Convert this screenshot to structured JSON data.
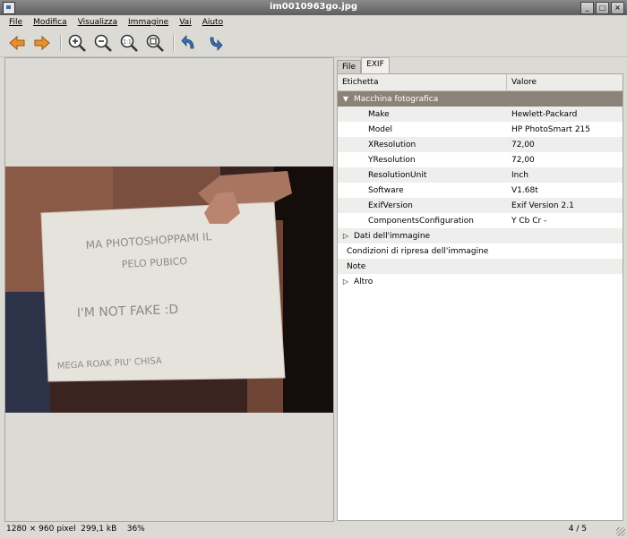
{
  "window": {
    "title": "im0010963go.jpg"
  },
  "menu": [
    "File",
    "Modifica",
    "Visualizza",
    "Immagine",
    "Vai",
    "Aiuto"
  ],
  "toolbar": {
    "icons": [
      "arrow-left-icon",
      "arrow-right-icon",
      "zoom-in-icon",
      "zoom-out-icon",
      "zoom-fit-icon",
      "zoom-original-icon",
      "rotate-left-icon",
      "rotate-right-icon"
    ],
    "accent": "#e8912a",
    "rotate_color": "#3a6fb4"
  },
  "photo": {
    "sign_lines": [
      "MA PHOTOSHOPPAMI IL",
      "PELO PUBICO",
      "I'M NOT FAKE :D",
      "MEGA ROAK PIU' CHISA"
    ]
  },
  "sidebar": {
    "tabs": [
      "File",
      "EXIF"
    ],
    "active_tab": "EXIF",
    "columns": [
      "Etichetta",
      "Valore"
    ],
    "rows": [
      {
        "label": "Macchina fotografica",
        "value": "",
        "level": 0,
        "expander": "expanded",
        "selected": true
      },
      {
        "label": "Make",
        "value": "Hewlett-Packard",
        "level": 1
      },
      {
        "label": "Model",
        "value": "HP PhotoSmart 215",
        "level": 1
      },
      {
        "label": "XResolution",
        "value": "72,00",
        "level": 1
      },
      {
        "label": "YResolution",
        "value": "72,00",
        "level": 1
      },
      {
        "label": "ResolutionUnit",
        "value": "Inch",
        "level": 1
      },
      {
        "label": "Software",
        "value": "V1.68t",
        "level": 1
      },
      {
        "label": "ExifVersion",
        "value": "Exif Version 2.1",
        "level": 1
      },
      {
        "label": "ComponentsConfiguration",
        "value": "Y Cb Cr -",
        "level": 1
      },
      {
        "label": "Dati dell'immagine",
        "value": "",
        "level": 0,
        "expander": "collapsed"
      },
      {
        "label": "Condizioni di ripresa dell'immagine",
        "value": "",
        "level": 0,
        "expander": "none"
      },
      {
        "label": "Note",
        "value": "",
        "level": 0,
        "expander": "none"
      },
      {
        "label": "Altro",
        "value": "",
        "level": 0,
        "expander": "collapsed"
      }
    ]
  },
  "status": {
    "dimensions": "1280 × 960 pixel",
    "size": "299,1 kB",
    "zoom": "36%",
    "position": "4 / 5"
  }
}
